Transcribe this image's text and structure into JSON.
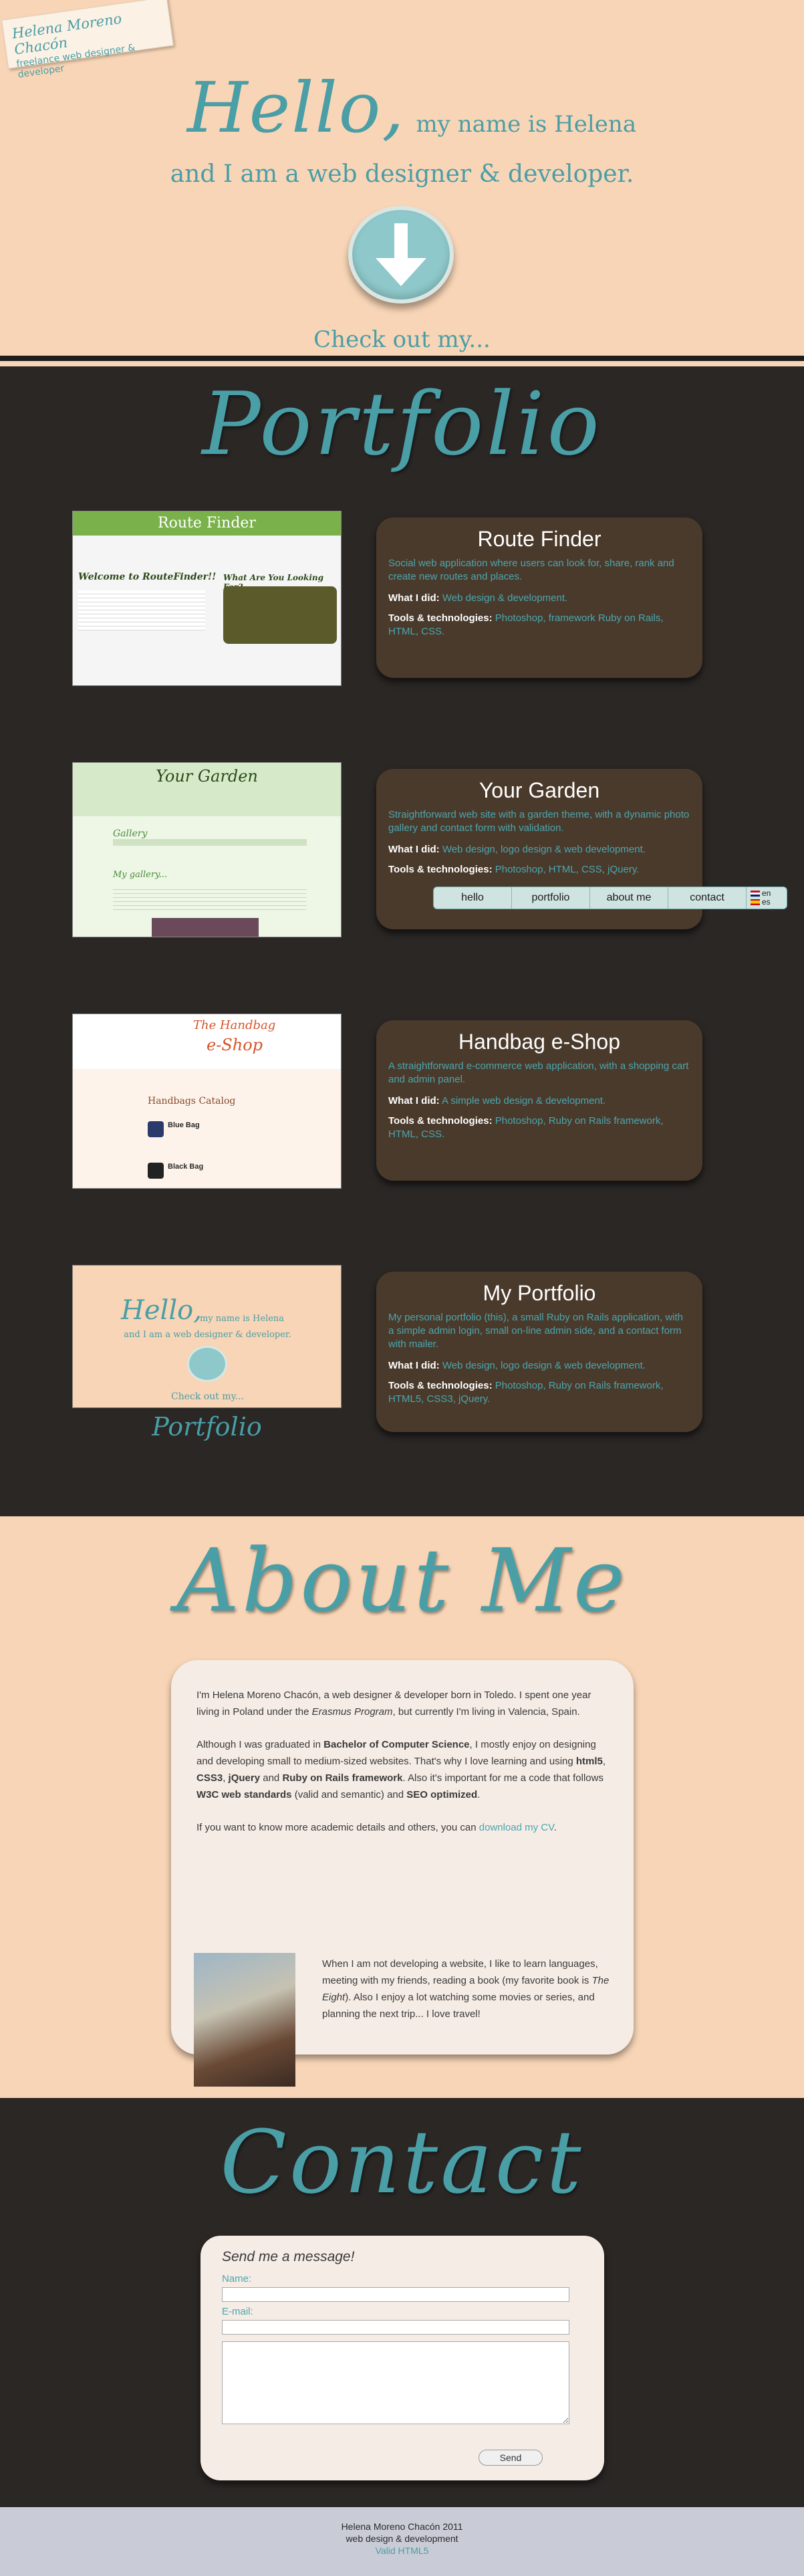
{
  "logo": {
    "name": "Helena Moreno Chacón",
    "tagline": "freelance web designer & developer"
  },
  "hero": {
    "hello": "Hello,",
    "intro": "my name is Helena",
    "subline": "and I am a web designer & developer.",
    "down_icon": "arrow-down-icon",
    "cta": "Check out my..."
  },
  "portfolio": {
    "heading": "Portfolio",
    "projects": [
      {
        "title": "Route Finder",
        "description": "Social web application where users can look for, share, rank and create new routes and places.",
        "what_label": "What I did:",
        "what": "Web design & development.",
        "tools_label": "Tools & technologies:",
        "tools": "Photoshop, framework Ruby on Rails, HTML, CSS.",
        "thumb": {
          "header": "Route Finder",
          "welcome": "Welcome to RouteFinder!!",
          "side": "What Are You Looking For?"
        }
      },
      {
        "title": "Your Garden",
        "description": "Straightforward web site with a garden theme, with a dynamic photo gallery and contact form with validation.",
        "what_label": "What I did:",
        "what": "Web design, logo design & web development.",
        "tools_label": "Tools & technologies:",
        "tools": "Photoshop, HTML, CSS, jQuery.",
        "thumb": {
          "header": "Your Garden",
          "greeting": "Gallery",
          "sub": "My gallery..."
        }
      },
      {
        "title": "Handbag e-Shop",
        "description": "A straightforward e-commerce web application, with a shopping cart and admin panel.",
        "what_label": "What I did:",
        "what": "A simple web design & development.",
        "tools_label": "Tools & technologies:",
        "tools": "Photoshop, Ruby on Rails framework, HTML, CSS.",
        "thumb": {
          "header1": "The Handbag",
          "header2": "e-Shop",
          "catalog": "Handbags Catalog",
          "item1": "Blue Bag",
          "item2": "Black Bag"
        }
      },
      {
        "title": "My Portfolio",
        "description": "My personal portfolio (this), a small Ruby on Rails application, with a simple admin login, small on-line admin side, and a contact form with mailer.",
        "what_label": "What I did:",
        "what": "Web design, logo design & web development.",
        "tools_label": "Tools & technologies:",
        "tools": "Photoshop, Ruby on Rails framework, HTML5, CSS3, jQuery.",
        "thumb": {
          "hello": "Hello,",
          "rest": "my name is Helena",
          "sub": "and I am a web designer & developer.",
          "cta": "Check out my...",
          "heading": "Portfolio"
        }
      }
    ]
  },
  "nav": {
    "items": [
      "hello",
      "portfolio",
      "about me",
      "contact"
    ],
    "langs": [
      "en",
      "es"
    ]
  },
  "about": {
    "heading": "About Me",
    "p1_a": "I'm Helena Moreno Chacón, a web designer & developer born in Toledo. I spent one year living in Poland under the ",
    "p1_em": "Erasmus Program",
    "p1_b": ", but currently I'm living in Valencia, Spain.",
    "p2_a": "Although I was graduated in ",
    "p2_b1": "Bachelor of Computer Science",
    "p2_b": ", I mostly enjoy on designing and developing small to medium-sized websites. That's why I love learning and using ",
    "p2_b2": "html5",
    "p2_c": ", ",
    "p2_b3": "CSS3",
    "p2_d": ", ",
    "p2_b4": "jQuery",
    "p2_e": " and ",
    "p2_b5": "Ruby on Rails framework",
    "p2_f": ". Also it's important for me a code that follows ",
    "p2_b6": "W3C web standards",
    "p2_g": " (valid and semantic) and ",
    "p2_b7": "SEO optimized",
    "p2_h": ".",
    "p3_a": "If you want to know more academic details and others, you can ",
    "p3_link": "download my CV",
    "p3_b": ".",
    "p4_a": "When I am not developing a website, I like to learn languages, meeting with my friends, reading a book (my favorite book is ",
    "p4_em": "The Eight",
    "p4_b": "). Also I enjoy a lot watching some movies or series, and planning the next trip... I love travel!"
  },
  "contact": {
    "heading": "Contact",
    "title": "Send me a message!",
    "name_label": "Name:",
    "email_label": "E-mail:",
    "send": "Send"
  },
  "footer": {
    "line1": "Helena Moreno Chacón 2011",
    "line2": "web design & development",
    "line3": "Valid HTML5"
  },
  "colors": {
    "accent": "#4a9ea6",
    "peach": "#f8d5b6",
    "dark": "#2a2725",
    "card": "#4a3a2b"
  }
}
